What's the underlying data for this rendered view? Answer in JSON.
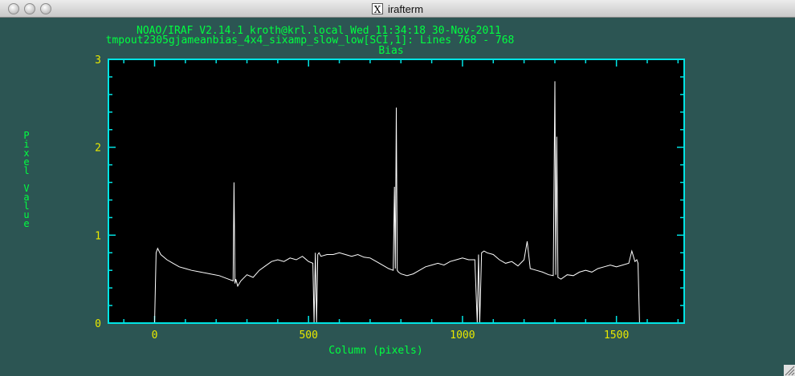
{
  "window": {
    "title": "irafterm",
    "app_icon": "x11-icon",
    "app_icon_glyph": "X"
  },
  "header": {
    "line1": "NOAO/IRAF V2.14.1 kroth@krl.local Wed 11:34:18 30-Nov-2011",
    "line2": "tmpout2305gjameanbias_4x4_sixamp_slow_low[SCI,1]: Lines 768 - 768"
  },
  "colors": {
    "background": "#2c5553",
    "frame": "#00e5e5",
    "text": "#00ff40",
    "ticklabels": "#e8e800",
    "plot_bg": "#000000",
    "line": "#ffffff"
  },
  "chart_data": {
    "type": "line",
    "title": "Bias",
    "xlabel": "Column (pixels)",
    "ylabel": "Pixel Value",
    "xlim": [
      -150,
      1720
    ],
    "ylim": [
      0,
      3
    ],
    "xticks": [
      0,
      500,
      1000,
      1500
    ],
    "yticks": [
      0,
      1,
      2,
      3
    ],
    "grid": false,
    "series": [
      {
        "x": [
          0,
          5,
          10,
          20,
          40,
          60,
          80,
          100,
          120,
          150,
          180,
          210,
          240,
          255,
          258,
          261,
          264,
          270,
          280,
          300,
          320,
          340,
          360,
          380,
          400,
          420,
          440,
          460,
          480,
          500,
          514,
          518,
          522,
          526,
          530,
          534,
          540,
          560,
          580,
          600,
          620,
          640,
          660,
          680,
          700,
          720,
          740,
          760,
          775,
          779,
          782,
          785,
          788,
          792,
          800,
          820,
          840,
          860,
          880,
          900,
          920,
          940,
          960,
          980,
          1000,
          1020,
          1040,
          1048,
          1052,
          1056,
          1062,
          1070,
          1080,
          1100,
          1120,
          1140,
          1160,
          1180,
          1200,
          1210,
          1220,
          1240,
          1260,
          1280,
          1295,
          1300,
          1303,
          1306,
          1310,
          1320,
          1340,
          1360,
          1380,
          1400,
          1420,
          1440,
          1460,
          1480,
          1500,
          1520,
          1540,
          1550,
          1560,
          1566,
          1570,
          1575
        ],
        "y": [
          0.0,
          0.8,
          0.85,
          0.78,
          0.72,
          0.68,
          0.64,
          0.62,
          0.6,
          0.58,
          0.56,
          0.54,
          0.5,
          0.48,
          1.6,
          0.45,
          0.5,
          0.42,
          0.48,
          0.55,
          0.52,
          0.6,
          0.65,
          0.7,
          0.72,
          0.7,
          0.74,
          0.72,
          0.76,
          0.7,
          0.68,
          0.0,
          0.8,
          0.0,
          0.78,
          0.8,
          0.76,
          0.78,
          0.78,
          0.8,
          0.78,
          0.76,
          0.78,
          0.75,
          0.74,
          0.7,
          0.66,
          0.62,
          0.6,
          1.55,
          0.62,
          2.45,
          0.6,
          0.58,
          0.56,
          0.54,
          0.56,
          0.6,
          0.64,
          0.66,
          0.68,
          0.66,
          0.7,
          0.72,
          0.74,
          0.72,
          0.72,
          0.0,
          0.78,
          0.0,
          0.8,
          0.82,
          0.8,
          0.78,
          0.72,
          0.68,
          0.7,
          0.65,
          0.72,
          0.93,
          0.62,
          0.6,
          0.58,
          0.55,
          0.54,
          2.75,
          0.55,
          2.12,
          0.52,
          0.5,
          0.55,
          0.54,
          0.58,
          0.6,
          0.58,
          0.62,
          0.64,
          0.66,
          0.64,
          0.66,
          0.68,
          0.82,
          0.7,
          0.72,
          0.68,
          0.0
        ]
      }
    ]
  }
}
